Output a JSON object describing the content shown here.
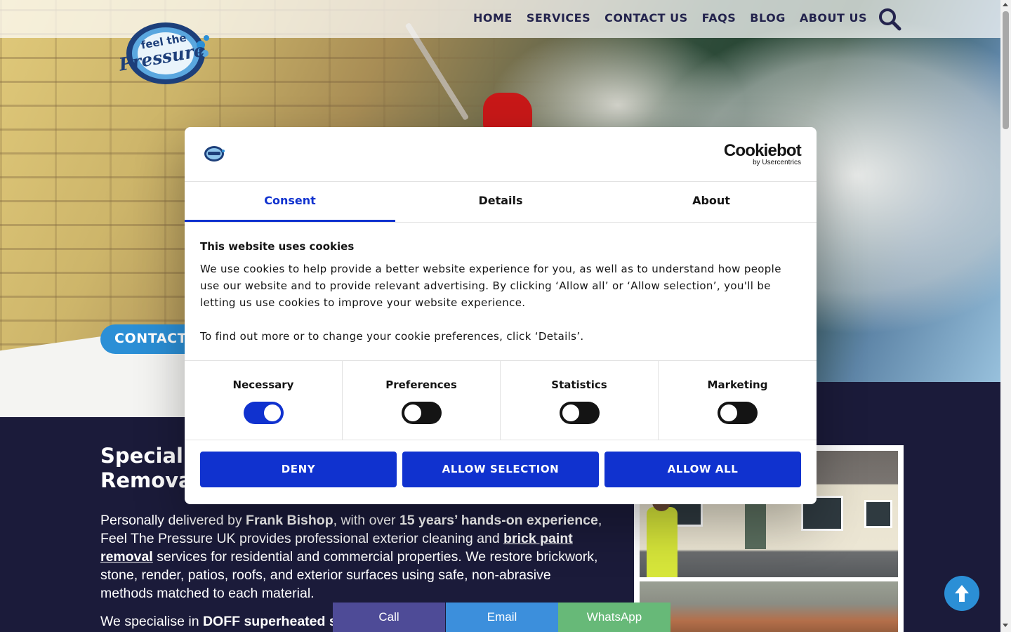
{
  "nav": {
    "items": [
      "HOME",
      "SERVICES",
      "CONTACT US",
      "FAQS",
      "BLOG",
      "ABOUT US"
    ]
  },
  "hero": {
    "contact_button": "CONTACT"
  },
  "main": {
    "heading_line1": "Speciali",
    "heading_line2": "Remova",
    "intro_p1": "Personally delivered by",
    "intro_name": "Frank Bishop",
    "intro_p2": ", with over",
    "intro_experience": "15 years’ hands-on experience",
    "intro_p3": ", Feel The Pressure UK provides professional exterior cleaning and",
    "intro_link": "brick paint removal",
    "intro_p4": "services for residential and commercial properties. We restore brickwork, stone, render, patios, roofs, and exterior surfaces using safe, non-abrasive methods matched to each material.",
    "intro2_start": "We specialise in",
    "intro2_bold": "DOFF superheated s"
  },
  "sticky_bar": {
    "call": "Call",
    "email": "Email",
    "whatsapp": "WhatsApp"
  },
  "cookie": {
    "brand_name": "Cookiebot",
    "brand_sub": "by Usercentrics",
    "tabs": [
      "Consent",
      "Details",
      "About"
    ],
    "active_tab": "Consent",
    "title": "This website uses cookies",
    "text_p1": "We use cookies to help provide a better website experience for you, as well as to understand how people use our website and to provide relevant advertising. By clicking ‘Allow all’ or ‘Allow selection’, you'll be letting us use cookies to improve your website experience.",
    "text_p2": "To find out more or to change your cookie preferences, click ‘Details’.",
    "categories": [
      {
        "label": "Necessary",
        "enabled": true
      },
      {
        "label": "Preferences",
        "enabled": false
      },
      {
        "label": "Statistics",
        "enabled": false
      },
      {
        "label": "Marketing",
        "enabled": false
      }
    ],
    "buttons": {
      "deny": "DENY",
      "allow_selection": "ALLOW SELECTION",
      "allow_all": "ALLOW ALL"
    }
  },
  "colors": {
    "navy": "#1b1b3a",
    "accent_blue": "#2b8fd6",
    "cookie_blue": "#1032cf",
    "call": "#4e4b97",
    "email": "#3c8fdc",
    "whatsapp": "#67b978"
  },
  "icons": {
    "search": "search-icon",
    "scroll_up": "arrow-up-icon",
    "logo": "feel-the-pressure-logo"
  }
}
